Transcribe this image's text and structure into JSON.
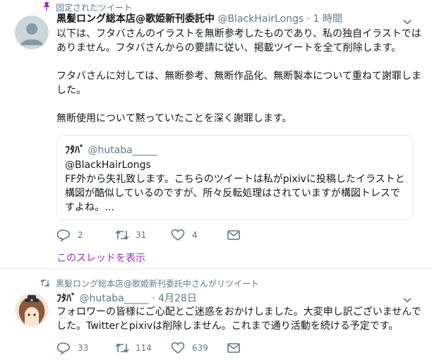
{
  "tweet1": {
    "context_label": "固定されたツイート",
    "context_icon": "pin-icon",
    "display_name": "黒髪ロング総本店@歌姫新刊委託中",
    "handle": "@BlackHairLongs",
    "separator": "·",
    "time": "1 時間",
    "body": [
      "以下は、フタバさんのイラストを無断参考したものであり、私の独自イラストではありません。フタバさんからの要請に従い、掲載ツイートを全て削除します。",
      "フタバさんに対しては、無断参考、無断作品化、無断製本について重ねて謝罪しました。",
      "無断使用について黙っていたことを深く謝罪します。"
    ],
    "quote": {
      "display_name": "ﾌﾀﾊﾞ",
      "handle": "@hutaba_____",
      "text_line1": "@BlackHairLongs",
      "text_rest": "FF外から失礼致します。こちらのツイートは私がpixivに投稿したイラストと構図が酷似しているのですが、所々反転処理はされていますが構図トレスですよね。…"
    },
    "actions": {
      "reply": "2",
      "retweet": "31",
      "like": "4"
    },
    "thread_link": "このスレッドを表示"
  },
  "tweet2": {
    "context_label": "黒髪ロング総本店@歌姫新刊委託中さんがリツイート",
    "context_icon": "retweet-icon",
    "display_name": "ﾌﾀﾊﾞ",
    "handle": "@hutaba_____",
    "separator": "·",
    "time": "4月28日",
    "body": "フォロワーの皆様にご心配とご迷惑をおかけしました。大変申し訳ございませんでした。Twitterとpixivは削除しません。これまで通り活動を続ける予定です。",
    "actions": {
      "reply": "33",
      "retweet": "114",
      "like": "639"
    }
  },
  "colors": {
    "text": "#14171a",
    "secondary": "#657786",
    "thread_link": "#9a2cc4",
    "pin": "#9a2cc4",
    "retweet_context": "#657786",
    "border": "#e6ecf0"
  }
}
